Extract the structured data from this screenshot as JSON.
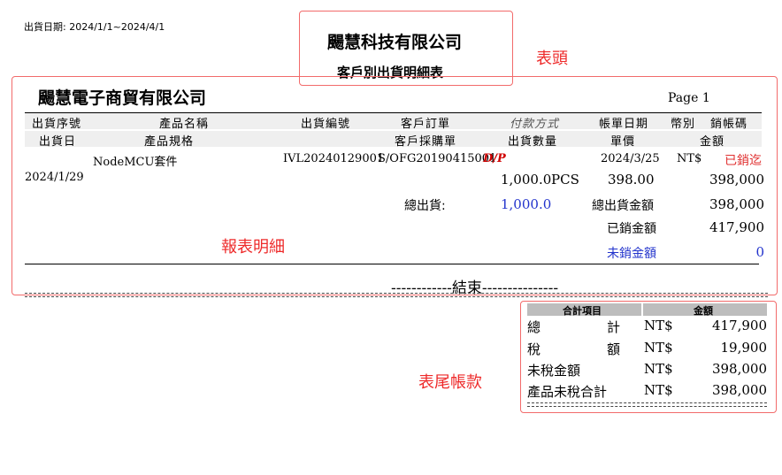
{
  "date_range": "出貨日期: 2024/1/1~2024/4/1",
  "header": {
    "company": "颺慧科技有限公司",
    "report_title": "客戶別出貨明細表"
  },
  "annotations": {
    "header": "表頭",
    "detail": "報表明細",
    "footer": "表尾帳款"
  },
  "detail": {
    "customer": "颺慧電子商貿有限公司",
    "page": "Page 1",
    "columns_row1": [
      "出貨序號",
      "產品名稱",
      "出貨編號",
      "客戶訂單",
      "付款方式",
      "帳單日期",
      "幣別",
      "銷帳碼"
    ],
    "columns_row2": [
      "出貨日",
      "產品規格",
      "客戶採購單",
      "出貨數量",
      "單價",
      "金額"
    ],
    "row": {
      "product": "NodeMCU套件",
      "ship_no": "IVL20240129001",
      "order_no": "S/OFG20190415001",
      "payment": "D/P",
      "bill_date": "2024/3/25",
      "currency": "NT$",
      "status": "已銷迄",
      "ship_date": "2024/1/29",
      "qty": "1,000.0",
      "unit": "PCS",
      "price": "398.00",
      "amount": "398,000"
    },
    "totals": {
      "ship_label": "總出貨:",
      "ship_value": "1,000.0",
      "amount_label": "總出貨金額",
      "amount_value": "398,000",
      "paid_label": "已銷金額",
      "paid_value": "417,900",
      "unpaid_label": "未銷金額",
      "unpaid_value": "0"
    },
    "end_text": "------------結束---------------"
  },
  "footer": {
    "headers": [
      "合計項目",
      "金額"
    ],
    "rows": [
      {
        "label_a": "總",
        "label_b": "計",
        "currency": "NT$",
        "amount": "417,900"
      },
      {
        "label_a": "稅",
        "label_b": "額",
        "currency": "NT$",
        "amount": "19,900"
      },
      {
        "label": "未稅金額",
        "currency": "NT$",
        "amount": "398,000"
      },
      {
        "label": "產品未稅合計",
        "currency": "NT$",
        "amount": "398,000"
      }
    ]
  },
  "colors": {
    "annotation": "#ee2a2a",
    "payment": "#d00000",
    "status": "#e03030",
    "blue": "#2233cc"
  }
}
